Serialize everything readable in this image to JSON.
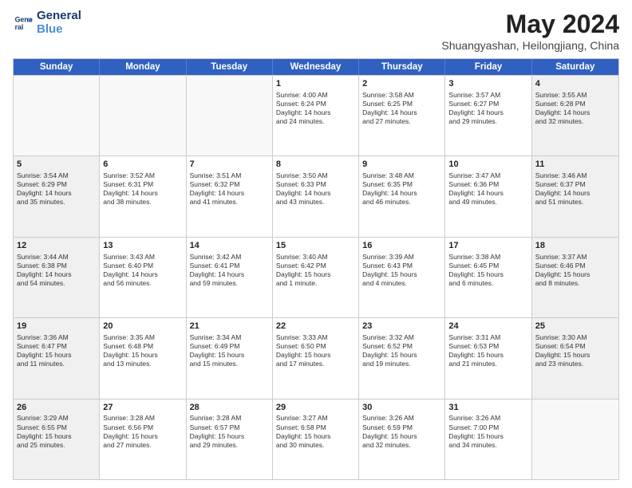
{
  "header": {
    "logo_line1": "General",
    "logo_line2": "Blue",
    "month_title": "May 2024",
    "location": "Shuangyashan, Heilongjiang, China"
  },
  "days_of_week": [
    "Sunday",
    "Monday",
    "Tuesday",
    "Wednesday",
    "Thursday",
    "Friday",
    "Saturday"
  ],
  "weeks": [
    [
      {
        "day": "",
        "info": "",
        "empty": true
      },
      {
        "day": "",
        "info": "",
        "empty": true
      },
      {
        "day": "",
        "info": "",
        "empty": true
      },
      {
        "day": "1",
        "info": "Sunrise: 4:00 AM\nSunset: 6:24 PM\nDaylight: 14 hours\nand 24 minutes.",
        "empty": false
      },
      {
        "day": "2",
        "info": "Sunrise: 3:58 AM\nSunset: 6:25 PM\nDaylight: 14 hours\nand 27 minutes.",
        "empty": false
      },
      {
        "day": "3",
        "info": "Sunrise: 3:57 AM\nSunset: 6:27 PM\nDaylight: 14 hours\nand 29 minutes.",
        "empty": false
      },
      {
        "day": "4",
        "info": "Sunrise: 3:55 AM\nSunset: 6:28 PM\nDaylight: 14 hours\nand 32 minutes.",
        "empty": false
      }
    ],
    [
      {
        "day": "5",
        "info": "Sunrise: 3:54 AM\nSunset: 6:29 PM\nDaylight: 14 hours\nand 35 minutes.",
        "empty": false
      },
      {
        "day": "6",
        "info": "Sunrise: 3:52 AM\nSunset: 6:31 PM\nDaylight: 14 hours\nand 38 minutes.",
        "empty": false
      },
      {
        "day": "7",
        "info": "Sunrise: 3:51 AM\nSunset: 6:32 PM\nDaylight: 14 hours\nand 41 minutes.",
        "empty": false
      },
      {
        "day": "8",
        "info": "Sunrise: 3:50 AM\nSunset: 6:33 PM\nDaylight: 14 hours\nand 43 minutes.",
        "empty": false
      },
      {
        "day": "9",
        "info": "Sunrise: 3:48 AM\nSunset: 6:35 PM\nDaylight: 14 hours\nand 46 minutes.",
        "empty": false
      },
      {
        "day": "10",
        "info": "Sunrise: 3:47 AM\nSunset: 6:36 PM\nDaylight: 14 hours\nand 49 minutes.",
        "empty": false
      },
      {
        "day": "11",
        "info": "Sunrise: 3:46 AM\nSunset: 6:37 PM\nDaylight: 14 hours\nand 51 minutes.",
        "empty": false
      }
    ],
    [
      {
        "day": "12",
        "info": "Sunrise: 3:44 AM\nSunset: 6:38 PM\nDaylight: 14 hours\nand 54 minutes.",
        "empty": false
      },
      {
        "day": "13",
        "info": "Sunrise: 3:43 AM\nSunset: 6:40 PM\nDaylight: 14 hours\nand 56 minutes.",
        "empty": false
      },
      {
        "day": "14",
        "info": "Sunrise: 3:42 AM\nSunset: 6:41 PM\nDaylight: 14 hours\nand 59 minutes.",
        "empty": false
      },
      {
        "day": "15",
        "info": "Sunrise: 3:40 AM\nSunset: 6:42 PM\nDaylight: 15 hours\nand 1 minute.",
        "empty": false
      },
      {
        "day": "16",
        "info": "Sunrise: 3:39 AM\nSunset: 6:43 PM\nDaylight: 15 hours\nand 4 minutes.",
        "empty": false
      },
      {
        "day": "17",
        "info": "Sunrise: 3:38 AM\nSunset: 6:45 PM\nDaylight: 15 hours\nand 6 minutes.",
        "empty": false
      },
      {
        "day": "18",
        "info": "Sunrise: 3:37 AM\nSunset: 6:46 PM\nDaylight: 15 hours\nand 8 minutes.",
        "empty": false
      }
    ],
    [
      {
        "day": "19",
        "info": "Sunrise: 3:36 AM\nSunset: 6:47 PM\nDaylight: 15 hours\nand 11 minutes.",
        "empty": false
      },
      {
        "day": "20",
        "info": "Sunrise: 3:35 AM\nSunset: 6:48 PM\nDaylight: 15 hours\nand 13 minutes.",
        "empty": false
      },
      {
        "day": "21",
        "info": "Sunrise: 3:34 AM\nSunset: 6:49 PM\nDaylight: 15 hours\nand 15 minutes.",
        "empty": false
      },
      {
        "day": "22",
        "info": "Sunrise: 3:33 AM\nSunset: 6:50 PM\nDaylight: 15 hours\nand 17 minutes.",
        "empty": false
      },
      {
        "day": "23",
        "info": "Sunrise: 3:32 AM\nSunset: 6:52 PM\nDaylight: 15 hours\nand 19 minutes.",
        "empty": false
      },
      {
        "day": "24",
        "info": "Sunrise: 3:31 AM\nSunset: 6:53 PM\nDaylight: 15 hours\nand 21 minutes.",
        "empty": false
      },
      {
        "day": "25",
        "info": "Sunrise: 3:30 AM\nSunset: 6:54 PM\nDaylight: 15 hours\nand 23 minutes.",
        "empty": false
      }
    ],
    [
      {
        "day": "26",
        "info": "Sunrise: 3:29 AM\nSunset: 6:55 PM\nDaylight: 15 hours\nand 25 minutes.",
        "empty": false
      },
      {
        "day": "27",
        "info": "Sunrise: 3:28 AM\nSunset: 6:56 PM\nDaylight: 15 hours\nand 27 minutes.",
        "empty": false
      },
      {
        "day": "28",
        "info": "Sunrise: 3:28 AM\nSunset: 6:57 PM\nDaylight: 15 hours\nand 29 minutes.",
        "empty": false
      },
      {
        "day": "29",
        "info": "Sunrise: 3:27 AM\nSunset: 6:58 PM\nDaylight: 15 hours\nand 30 minutes.",
        "empty": false
      },
      {
        "day": "30",
        "info": "Sunrise: 3:26 AM\nSunset: 6:59 PM\nDaylight: 15 hours\nand 32 minutes.",
        "empty": false
      },
      {
        "day": "31",
        "info": "Sunrise: 3:26 AM\nSunset: 7:00 PM\nDaylight: 15 hours\nand 34 minutes.",
        "empty": false
      },
      {
        "day": "",
        "info": "",
        "empty": true
      }
    ]
  ]
}
